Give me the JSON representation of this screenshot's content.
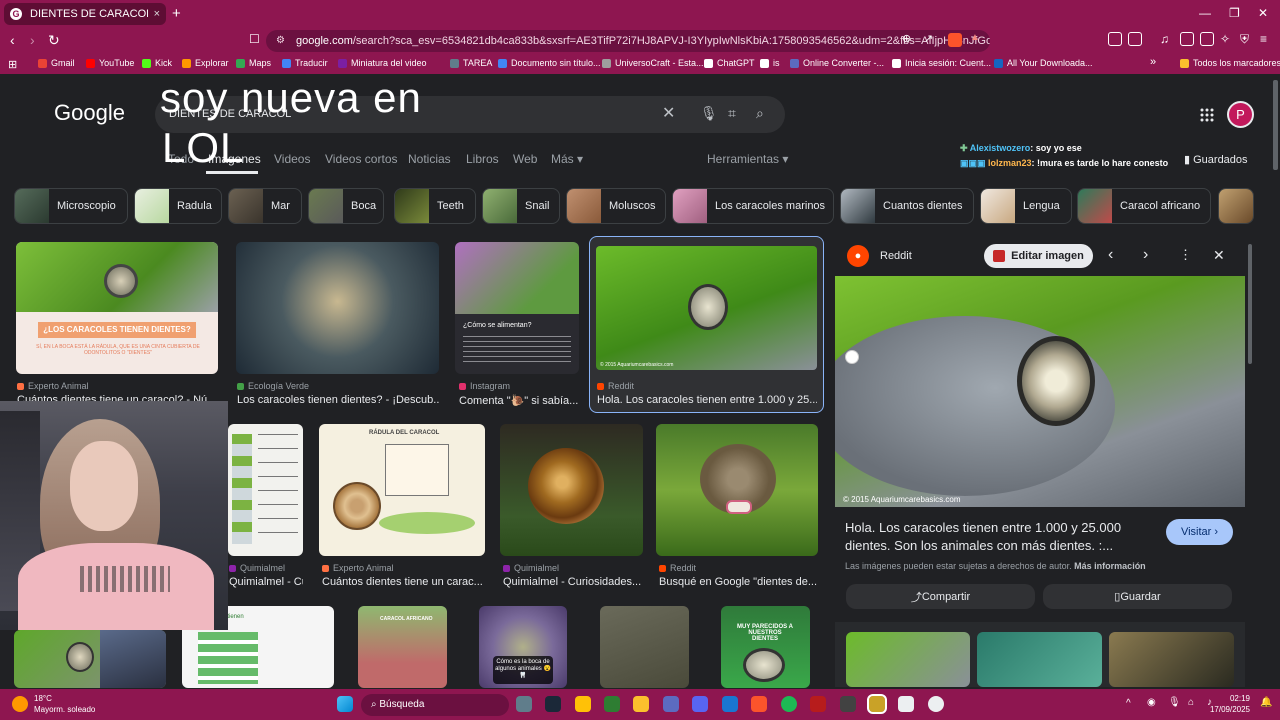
{
  "browser": {
    "tab_title": "DIENTES DE CARACOL - Buscar c",
    "tab_favicon": "G",
    "new_tab": "+",
    "url_host": "google.com",
    "url_rest": "/search?sca_esv=6534821db4ca833b&sxsrf=AE3TifP72i7HJ8APVJ-I3YIypIwNlsKbiA:1758093546562&udm=2&fbs=AIIjpHx4nJfGojP..."
  },
  "bookmarks": [
    "Gmail",
    "YouTube",
    "Kick",
    "Explorar",
    "Maps",
    "Traducir",
    "Miniatura del video",
    "TAREA",
    "Documento sin título...",
    "UniversoCraft - Esta...",
    "ChatGPT",
    "is",
    "Online Converter -...",
    "Inicia sesión: Cuent...",
    "All Your Downloada..."
  ],
  "bookmarks_more": "»",
  "bookmarks_folder": "Todos los marcadores",
  "google": {
    "logo": "Google",
    "query": "DIENTES DE CARACOL",
    "overlay_line1": "soy nueva en",
    "overlay_line2": "LOL",
    "tabs": [
      "Todo",
      "Imágenes",
      "Videos",
      "Videos cortos",
      "Noticias",
      "Libros",
      "Web",
      "Más ▾"
    ],
    "tools": "Herramientas ▾",
    "saved": "Guardados",
    "avatar": "P"
  },
  "chat": [
    {
      "user": "Alexistwozero",
      "msg": ": soy yo ese",
      "color": "#4fc3f7"
    },
    {
      "user": "lolzman23",
      "msg": ": !mura es tarde lo hare conesto",
      "color": "#ffb74d"
    }
  ],
  "chips": [
    "Microscopio",
    "Radula",
    "Mar",
    "Boca",
    "Teeth",
    "Snail",
    "Moluscos",
    "Los caracoles marinos",
    "Cuantos dientes",
    "Lengua",
    "Caracol africano"
  ],
  "results": [
    {
      "source": "Experto Animal",
      "title": "Cuántos dientes tiene un caracol? - Nú...",
      "caption": "¿LOS CARACOLES TIENEN DIENTES?",
      "subcaption": "SÍ, EN LA BOCA ESTÁ LA RÁDULA, QUE ES UNA CINTA CUBIERTA DE ODONTOLITOS O \"DIENTES\""
    },
    {
      "source": "Ecología Verde",
      "title": "Los caracoles tienen dientes? - ¡Descub..."
    },
    {
      "source": "Instagram",
      "title": "Comenta \"🐌\" si sabía...",
      "caption": "¿Cómo se alimentan?"
    },
    {
      "source": "Reddit",
      "title": "Hola. Los caracoles tienen entre 1.000 y 25...",
      "watermark": "© 2015 Aquariumcarebasics.com"
    },
    {
      "source": "Quimialmel",
      "title": "Quimialmel - Curio..."
    },
    {
      "source": "Experto Animal",
      "title": "Cuántos dientes tiene un carac...",
      "caption": "RÁDULA DEL CARACOL"
    },
    {
      "source": "Quimialmel",
      "title": "Quimialmel - Curiosidades..."
    },
    {
      "source": "Reddit",
      "title": "Busqué en Google \"dientes de..."
    }
  ],
  "bottom_row_captions": [
    "Cómo es la boca de algunos animales 😮🦷",
    "CARACOL AFRICANO",
    "MUY PARECIDOS A NUESTROS DIENTES",
    "caracoles tienen dientes?"
  ],
  "panel": {
    "source": "Reddit",
    "edit_button": "Editar imagen",
    "watermark": "© 2015 Aquariumcarebasics.com",
    "title": "Hola. Los caracoles tienen entre 1.000 y 25.000 dientes. Son los animales con más dientes. :...",
    "visit_button": "Visitar",
    "copyright": "Las imágenes pueden estar sujetas a derechos de autor.",
    "more_info": "Más información",
    "share_button": "Compartir",
    "save_button": "Guardar"
  },
  "taskbar": {
    "weather_temp": "18°C",
    "weather_desc": "Mayorm. soleado",
    "search_placeholder": "Búsqueda",
    "time": "02:19",
    "date": "17/09/2025"
  },
  "colors": {
    "accent": "#8e1650",
    "selected_border": "#8ab4f8",
    "visit_button": "#a8c7fa"
  }
}
